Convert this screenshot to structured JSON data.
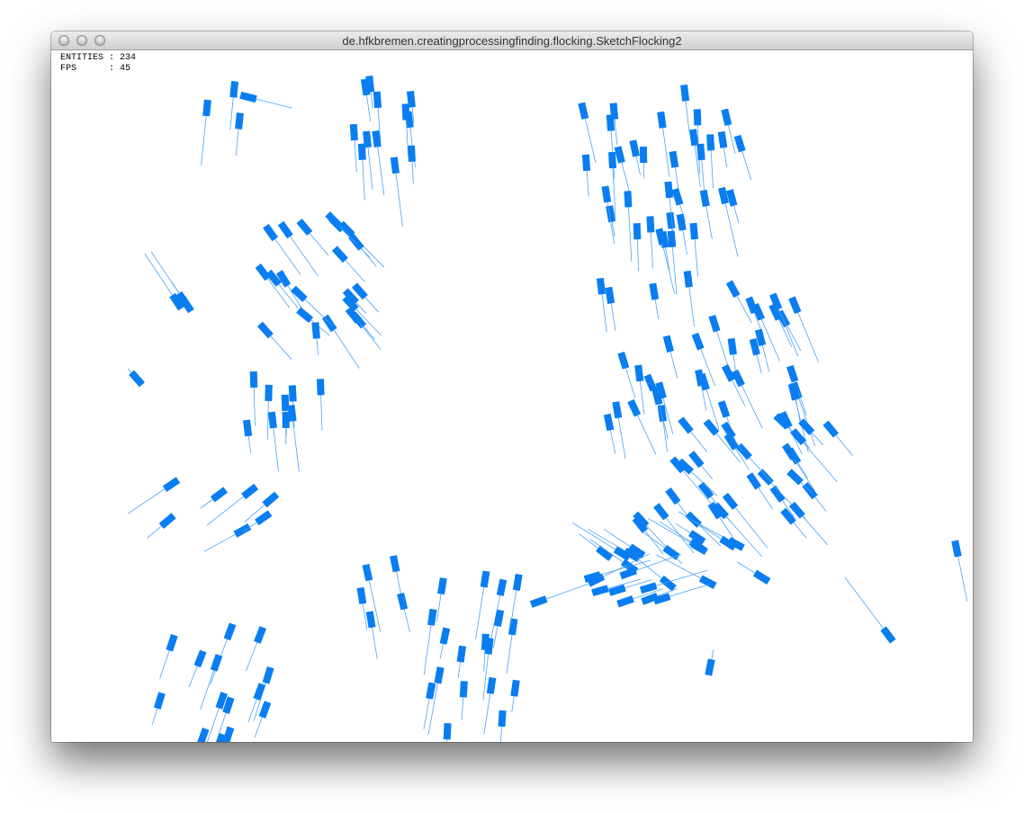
{
  "window": {
    "title": "de.hfkbremen.creatingprocessingfinding.flocking.SketchFlocking2",
    "controls": [
      "close",
      "minimize",
      "zoom"
    ]
  },
  "hud": {
    "entities_label": "ENTITIES",
    "entities_value": "234",
    "fps_label": "FPS",
    "fps_value": "45"
  },
  "colors": {
    "boid": "#0a7df0",
    "trail": "#4aa3f5",
    "background": "#ffffff"
  }
}
